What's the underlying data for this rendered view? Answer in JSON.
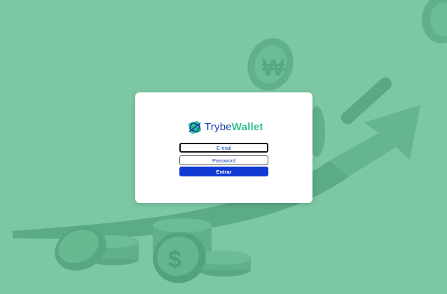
{
  "brand": {
    "name_part1": "Trybe",
    "name_part2": "Wallet",
    "logo_icon": "wallet-logo-icon"
  },
  "login": {
    "email_placeholder": "E-mail",
    "password_placeholder": "Password",
    "submit_label": "Entrar"
  },
  "colors": {
    "background": "#7cc7a4",
    "card": "#ffffff",
    "brand_blue": "#0d3cb3",
    "brand_green": "#2fc18c",
    "button": "#0f3bd4"
  }
}
